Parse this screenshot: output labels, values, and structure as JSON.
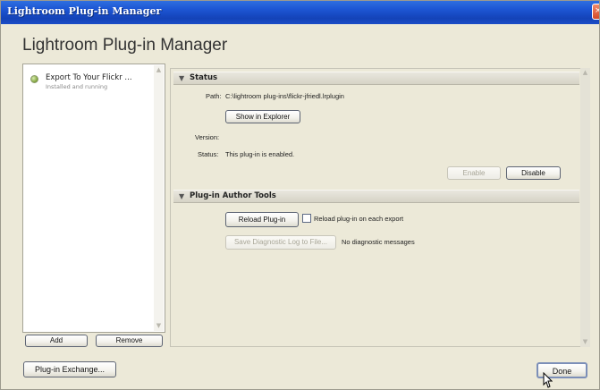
{
  "window": {
    "title": "Lightroom Plug-in Manager",
    "close_glyph": "×"
  },
  "heading": "Lightroom Plug-in Manager",
  "plugins": [
    {
      "name": "Export To Your Flickr ...",
      "status": "Installed and running",
      "status_color": "#7fa33a"
    }
  ],
  "plugin_list_buttons": {
    "add": "Add",
    "remove": "Remove"
  },
  "status_section": {
    "title": "Status",
    "path_label": "Path:",
    "path_value": "C:\\lightroom plug-ins\\flickr-jfriedl.lrplugin",
    "show_in_explorer": "Show in Explorer",
    "version_label": "Version:",
    "version_value": "",
    "status_label": "Status:",
    "status_value": "This plug-in is enabled.",
    "enable": "Enable",
    "disable": "Disable"
  },
  "author_tools_section": {
    "title": "Plug-in Author Tools",
    "reload": "Reload Plug-in",
    "reload_on_export": "Reload plug-in on each export",
    "reload_on_export_checked": false,
    "save_log": "Save Diagnostic Log to File...",
    "diagnostic_message": "No diagnostic messages"
  },
  "footer": {
    "plugin_exchange": "Plug-in Exchange...",
    "done": "Done"
  },
  "colors": {
    "title_bar": "#1d56d4",
    "dialog_background": "#ece9d8",
    "button_border": "#5d6473"
  },
  "icons": {
    "collapse": "triangle-down-icon",
    "close": "close-icon",
    "cursor": "mouse-pointer-icon"
  }
}
